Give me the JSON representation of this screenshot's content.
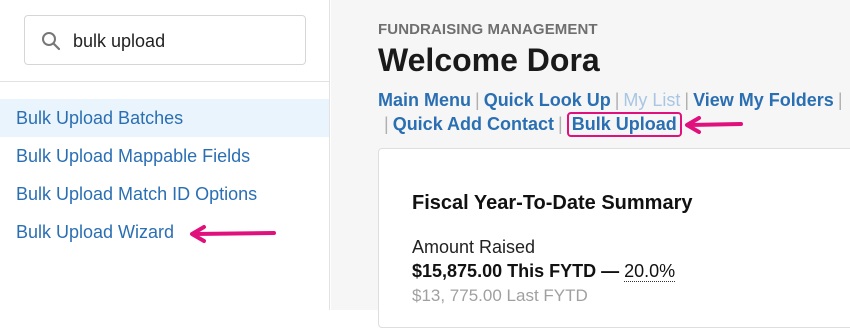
{
  "search": {
    "value": "bulk upload",
    "icon": "search-icon"
  },
  "sidebar": {
    "items": [
      {
        "label": "Bulk Upload Batches",
        "active": true
      },
      {
        "label": "Bulk Upload Mappable Fields",
        "active": false
      },
      {
        "label": "Bulk Upload Match ID Options",
        "active": false
      },
      {
        "label": "Bulk Upload Wizard",
        "active": false
      }
    ]
  },
  "header": {
    "section": "FUNDRAISING MANAGEMENT",
    "title": "Welcome Dora"
  },
  "nav": {
    "links": [
      {
        "label": "Main Menu"
      },
      {
        "label": "Quick Look Up"
      },
      {
        "label": "My List",
        "disabled": true
      },
      {
        "label": "View My Folders"
      },
      {
        "label": "Quick Add Contact"
      },
      {
        "label": "Bulk Upload",
        "highlighted": true
      }
    ],
    "separator": "|"
  },
  "summary": {
    "title": "Fiscal Year-To-Date Summary",
    "label": "Amount Raised",
    "current_amount": "$15,875.00 This FYTD",
    "dash": "—",
    "percent": "20.0%",
    "last": "$13, 775.00 Last FYTD"
  },
  "annotation": {
    "arrow_color": "#e0107c",
    "highlight_color": "#e0107c"
  }
}
